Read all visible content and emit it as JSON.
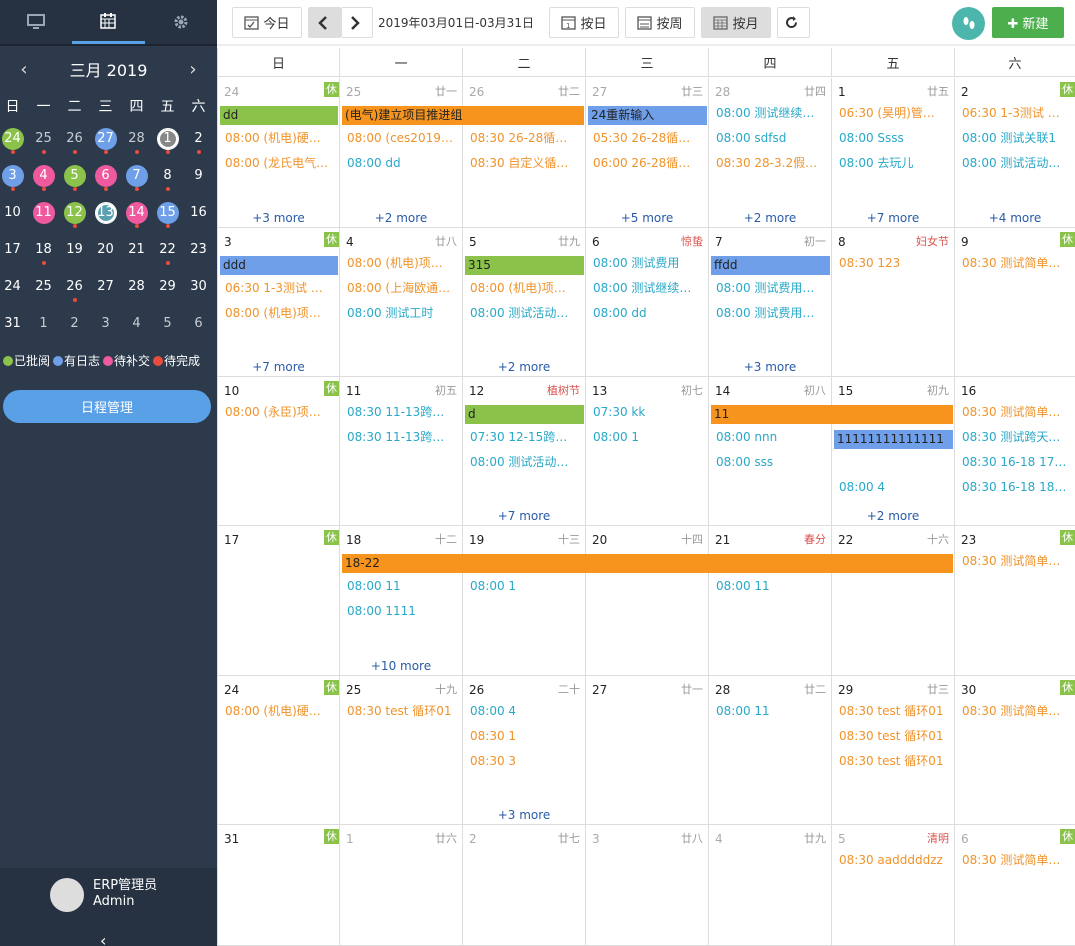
{
  "sidebar": {
    "tabs": [
      {
        "icon": "monitor-icon"
      },
      {
        "icon": "calendar-icon"
      },
      {
        "icon": "gear-icon"
      }
    ],
    "month_title": "三月 2019",
    "prev": "‹",
    "next": "›",
    "weekdays": [
      "日",
      "一",
      "二",
      "三",
      "四",
      "五",
      "六"
    ],
    "days": [
      {
        "n": "24",
        "c": "#8bc34a",
        "d": true,
        "o": true
      },
      {
        "n": "25",
        "d": true,
        "o": true
      },
      {
        "n": "26",
        "d": true,
        "o": true
      },
      {
        "n": "27",
        "c": "#6f9fe8",
        "d": true,
        "o": true
      },
      {
        "n": "28",
        "d": true,
        "o": true
      },
      {
        "n": "1",
        "c": "#888888",
        "ring": true,
        "d": true
      },
      {
        "n": "2",
        "d": true
      },
      {
        "n": "3",
        "c": "#6f9fe8",
        "d": true
      },
      {
        "n": "4",
        "c": "#ef5a9f",
        "d": true
      },
      {
        "n": "5",
        "c": "#8bc34a",
        "d": true
      },
      {
        "n": "6",
        "c": "#ef5a9f",
        "d": true
      },
      {
        "n": "7",
        "c": "#6f9fe8",
        "d": true
      },
      {
        "n": "8",
        "d": true
      },
      {
        "n": "9"
      },
      {
        "n": "10"
      },
      {
        "n": "11",
        "c": "#ef5a9f"
      },
      {
        "n": "12",
        "c": "#8bc34a",
        "d": true
      },
      {
        "n": "13",
        "c": "#5aa0b0",
        "ring": true
      },
      {
        "n": "14",
        "c": "#ef5a9f",
        "d": true
      },
      {
        "n": "15",
        "c": "#6f9fe8",
        "d": true
      },
      {
        "n": "16"
      },
      {
        "n": "17"
      },
      {
        "n": "18",
        "d": true
      },
      {
        "n": "19"
      },
      {
        "n": "20"
      },
      {
        "n": "21"
      },
      {
        "n": "22",
        "d": true
      },
      {
        "n": "23"
      },
      {
        "n": "24"
      },
      {
        "n": "25"
      },
      {
        "n": "26",
        "d": true
      },
      {
        "n": "27"
      },
      {
        "n": "28"
      },
      {
        "n": "29"
      },
      {
        "n": "30"
      },
      {
        "n": "31"
      },
      {
        "n": "1",
        "o": true
      },
      {
        "n": "2",
        "o": true
      },
      {
        "n": "3",
        "o": true
      },
      {
        "n": "4",
        "o": true
      },
      {
        "n": "5",
        "o": true
      },
      {
        "n": "6",
        "o": true
      }
    ],
    "legend": [
      {
        "label": "已批阅",
        "color": "#8bc34a"
      },
      {
        "label": "有日志",
        "color": "#6f9fe8"
      },
      {
        "label": "待补交",
        "color": "#ef5a9f"
      },
      {
        "label": "待完成",
        "color": "#e74c3c"
      }
    ],
    "schedule_button": "日程管理",
    "user": {
      "name": "ERP管理员",
      "login": "Admin"
    },
    "collapse": "‹"
  },
  "toolbar": {
    "today": "今日",
    "range": "2019年03月01日-03月31日",
    "by_day": "按日",
    "by_week": "按周",
    "by_month": "按月",
    "new": "新建"
  },
  "calendar": {
    "headers": [
      "日",
      "一",
      "二",
      "三",
      "四",
      "五",
      "六"
    ],
    "weeks": [
      {
        "days": [
          {
            "n": "24",
            "l": "休",
            "lt": "rest",
            "o": true,
            "ev": [
              {
                "t": "08:00 (机电)硬…",
                "c": "o"
              },
              {
                "t": "08:00 (龙氏电气…",
                "c": "o"
              }
            ],
            "more": "+3 more"
          },
          {
            "n": "25",
            "l": "廿一",
            "o": true,
            "ev": [
              {
                "t": "08:00 (ces2019…",
                "c": "o"
              },
              {
                "t": "08:00 dd",
                "c": "t"
              }
            ],
            "more": "+2 more"
          },
          {
            "n": "26",
            "l": "廿二",
            "o": true,
            "ev": [
              {
                "t": "08:30 26-28循…",
                "c": "o"
              },
              {
                "t": "08:30 自定义循…",
                "c": "o"
              }
            ]
          },
          {
            "n": "27",
            "l": "廿三",
            "o": true,
            "ev": [
              {
                "t": "05:30 26-28循…",
                "c": "o"
              },
              {
                "t": "06:00 26-28循…",
                "c": "o"
              }
            ],
            "more": "+5 more"
          },
          {
            "n": "28",
            "l": "廿四",
            "o": true,
            "ev": [
              {
                "t": "08:00 测试继续…",
                "c": "t"
              },
              {
                "t": "08:00 sdfsd",
                "c": "t"
              },
              {
                "t": "08:30 28-3.2假…",
                "c": "o"
              }
            ],
            "more": "+2 more"
          },
          {
            "n": "1",
            "l": "廿五",
            "ev": [
              {
                "t": "06:30 (昊明)管…",
                "c": "o"
              },
              {
                "t": "08:00 Ssss",
                "c": "t"
              },
              {
                "t": "08:00 去玩儿",
                "c": "t"
              }
            ],
            "more": "+7 more"
          },
          {
            "n": "2",
            "l": "休",
            "lt": "rest",
            "ev": [
              {
                "t": "06:30 1-3测试 …",
                "c": "o"
              },
              {
                "t": "08:00 测试关联1",
                "c": "t"
              },
              {
                "t": "08:00 测试活动…",
                "c": "t"
              }
            ],
            "more": "+4 more"
          }
        ],
        "bars": [
          {
            "t": "dd",
            "c": "g",
            "s": 0,
            "e": 0
          },
          {
            "t": "(电气)建立项目推进组",
            "c": "or",
            "s": 1,
            "e": 2
          },
          {
            "t": "24重新输入",
            "c": "b",
            "s": 3,
            "e": 3
          }
        ]
      },
      {
        "days": [
          {
            "n": "3",
            "l": "休",
            "lt": "rest",
            "ev": [
              {
                "t": "06:30 1-3测试 …",
                "c": "o"
              },
              {
                "t": "08:00 (机电)项…",
                "c": "o"
              }
            ],
            "more": "+7 more"
          },
          {
            "n": "4",
            "l": "廿八",
            "ev": [
              {
                "t": "08:00 (机电)项…",
                "c": "o"
              },
              {
                "t": "08:00 (上海欧通…",
                "c": "o"
              },
              {
                "t": "08:00 测试工时",
                "c": "t"
              }
            ]
          },
          {
            "n": "5",
            "l": "廿九",
            "ev": [
              {
                "t": "08:00 (机电)项…",
                "c": "o"
              },
              {
                "t": "08:00 测试活动…",
                "c": "t"
              }
            ],
            "more": "+2 more"
          },
          {
            "n": "6",
            "l": "惊蛰",
            "lt": "fest",
            "ev": [
              {
                "t": "08:00 测试费用",
                "c": "t"
              },
              {
                "t": "08:00 测试继续…",
                "c": "t"
              },
              {
                "t": "08:00 dd",
                "c": "t"
              }
            ]
          },
          {
            "n": "7",
            "l": "初一",
            "ev": [
              {
                "t": "08:00 测试费用…",
                "c": "t"
              },
              {
                "t": "08:00 测试费用…",
                "c": "t"
              }
            ],
            "more": "+3 more"
          },
          {
            "n": "8",
            "l": "妇女节",
            "lt": "fest",
            "ev": [
              {
                "t": "08:30 123",
                "c": "o"
              }
            ]
          },
          {
            "n": "9",
            "l": "休",
            "lt": "rest",
            "ev": [
              {
                "t": "08:30 测试简单…",
                "c": "o"
              }
            ]
          }
        ],
        "bars": [
          {
            "t": "ddd",
            "c": "b",
            "s": 0,
            "e": 0
          },
          {
            "t": "315",
            "c": "g",
            "s": 2,
            "e": 2
          },
          {
            "t": "ffdd",
            "c": "b",
            "s": 4,
            "e": 4
          }
        ]
      },
      {
        "days": [
          {
            "n": "10",
            "l": "休",
            "lt": "rest",
            "ev": [
              {
                "t": "08:00 (永臣)项…",
                "c": "o"
              }
            ]
          },
          {
            "n": "11",
            "l": "初五",
            "ev": [
              {
                "t": "08:30 11-13跨…",
                "c": "t"
              },
              {
                "t": "08:30 11-13跨…",
                "c": "t"
              }
            ]
          },
          {
            "n": "12",
            "l": "植树节",
            "lt": "fest",
            "ev": [
              {
                "t": "07:30 12-15跨…",
                "c": "t"
              },
              {
                "t": "08:00 测试活动…",
                "c": "t"
              }
            ],
            "more": "+7 more"
          },
          {
            "n": "13",
            "l": "初七",
            "ev": [
              {
                "t": "07:30 kk",
                "c": "t"
              },
              {
                "t": "08:00 1",
                "c": "t"
              }
            ]
          },
          {
            "n": "14",
            "l": "初八",
            "ev": [
              {
                "t": "08:00 nnn",
                "c": "t"
              },
              {
                "t": "08:00 sss",
                "c": "t"
              }
            ]
          },
          {
            "n": "15",
            "l": "初九",
            "ev": [
              {
                "t": "08:00 4",
                "c": "t"
              }
            ],
            "more": "+2 more",
            "row": 1
          },
          {
            "n": "16",
            "l": "",
            "ev": [
              {
                "t": "08:30 测试简单…",
                "c": "o"
              },
              {
                "t": "08:30 测试跨天…",
                "c": "t"
              },
              {
                "t": "08:30 16-18 17Act",
                "c": "t"
              },
              {
                "t": "08:30 16-18 18Act",
                "c": "t"
              }
            ]
          }
        ],
        "bars": [
          {
            "t": "d",
            "c": "g",
            "s": 2,
            "e": 2
          },
          {
            "t": "11",
            "c": "or",
            "s": 4,
            "e": 5
          },
          {
            "t": "11111111111111",
            "c": "b",
            "s": 5,
            "e": 5,
            "row": 1
          }
        ]
      },
      {
        "days": [
          {
            "n": "17",
            "l": "休",
            "lt": "rest",
            "ev": []
          },
          {
            "n": "18",
            "l": "十二",
            "ev": [
              {
                "t": "08:00 11",
                "c": "t"
              },
              {
                "t": "08:00 1111",
                "c": "t"
              }
            ],
            "more": "+10 more"
          },
          {
            "n": "19",
            "l": "十三",
            "ev": [
              {
                "t": "08:00 1",
                "c": "t"
              }
            ]
          },
          {
            "n": "20",
            "l": "十四",
            "ev": []
          },
          {
            "n": "21",
            "l": "春分",
            "lt": "fest",
            "ev": [
              {
                "t": "08:00 11",
                "c": "t"
              }
            ]
          },
          {
            "n": "22",
            "l": "十六",
            "ev": []
          },
          {
            "n": "23",
            "l": "休",
            "lt": "rest",
            "ev": [
              {
                "t": "08:30 测试简单…",
                "c": "o"
              }
            ],
            "row": -1
          }
        ],
        "bars": [
          {
            "t": "18-22",
            "c": "or",
            "s": 1,
            "e": 5
          }
        ]
      },
      {
        "days": [
          {
            "n": "24",
            "l": "休",
            "lt": "rest",
            "ev": [
              {
                "t": "08:00 (机电)硬…",
                "c": "o"
              }
            ],
            "row": -1
          },
          {
            "n": "25",
            "l": "十九",
            "ev": [
              {
                "t": "08:30 test 循环01",
                "c": "o"
              }
            ],
            "row": -1
          },
          {
            "n": "26",
            "l": "二十",
            "ev": [
              {
                "t": "08:00 4",
                "c": "t"
              },
              {
                "t": "08:30 1",
                "c": "o"
              },
              {
                "t": "08:30 3",
                "c": "o"
              }
            ],
            "more": "+3 more",
            "row": -1
          },
          {
            "n": "27",
            "l": "廿一",
            "ev": []
          },
          {
            "n": "28",
            "l": "廿二",
            "ev": [
              {
                "t": "08:00 11",
                "c": "t"
              }
            ],
            "row": -1
          },
          {
            "n": "29",
            "l": "廿三",
            "ev": [
              {
                "t": "08:30 test 循环01",
                "c": "o"
              },
              {
                "t": "08:30 test 循环01",
                "c": "o"
              },
              {
                "t": "08:30 test 循环01",
                "c": "o"
              }
            ],
            "row": -1
          },
          {
            "n": "30",
            "l": "休",
            "lt": "rest",
            "ev": [
              {
                "t": "08:30 测试简单…",
                "c": "o"
              }
            ],
            "row": -1
          }
        ],
        "bars": []
      },
      {
        "days": [
          {
            "n": "31",
            "l": "休",
            "lt": "rest",
            "ev": []
          },
          {
            "n": "1",
            "l": "廿六",
            "o": true,
            "ev": []
          },
          {
            "n": "2",
            "l": "廿七",
            "o": true,
            "ev": []
          },
          {
            "n": "3",
            "l": "廿八",
            "o": true,
            "ev": []
          },
          {
            "n": "4",
            "l": "廿九",
            "o": true,
            "ev": []
          },
          {
            "n": "5",
            "l": "清明",
            "lt": "fest",
            "o": true,
            "ev": [
              {
                "t": "08:30 aadddddzz",
                "c": "o"
              }
            ],
            "row": -1
          },
          {
            "n": "6",
            "l": "休",
            "lt": "rest",
            "o": true,
            "ev": [
              {
                "t": "08:30 测试简单…",
                "c": "o"
              }
            ],
            "row": -1
          }
        ],
        "bars": []
      }
    ]
  }
}
